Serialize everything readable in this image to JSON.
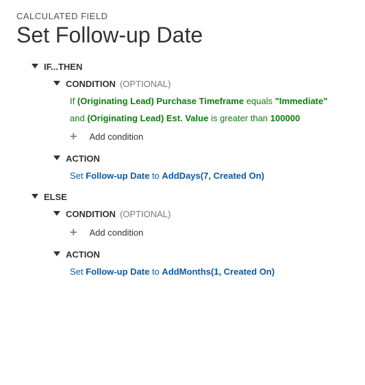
{
  "breadcrumb": "CALCULATED FIELD",
  "title": "Set Follow-up Date",
  "ifThen": {
    "label": "IF...THEN",
    "condition": {
      "label": "CONDITION",
      "optional": "(OPTIONAL)",
      "lines": [
        {
          "prefix": "If",
          "field": "(Originating Lead) Purchase Timeframe",
          "operator": "equals",
          "value": "\"Immediate\""
        },
        {
          "prefix": "and",
          "field": "(Originating Lead) Est. Value",
          "operator": "is greater than",
          "value": "100000"
        }
      ],
      "addLabel": "Add condition"
    },
    "action": {
      "label": "ACTION",
      "line": {
        "prefix": "Set",
        "field": "Follow-up Date",
        "middle": "to",
        "fn": "AddDays(7, Created On)"
      }
    }
  },
  "else": {
    "label": "ELSE",
    "condition": {
      "label": "CONDITION",
      "optional": "(OPTIONAL)",
      "addLabel": "Add condition"
    },
    "action": {
      "label": "ACTION",
      "line": {
        "prefix": "Set",
        "field": "Follow-up Date",
        "middle": "to",
        "fn": "AddMonths(1, Created On)"
      }
    }
  }
}
